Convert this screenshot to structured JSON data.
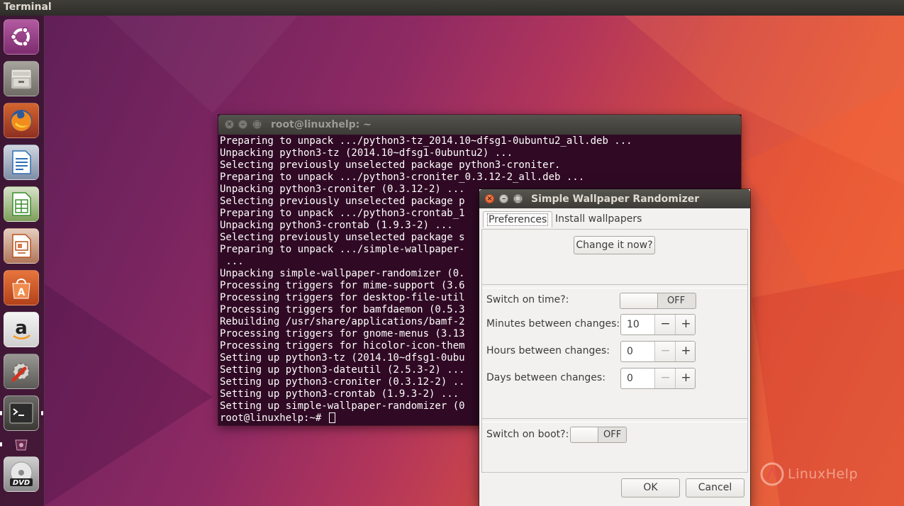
{
  "top_panel": {
    "title": "Terminal"
  },
  "launcher": {
    "items": [
      {
        "name": "dash-home",
        "icon": "ubuntu-logo-icon"
      },
      {
        "name": "files",
        "icon": "file-cabinet-icon"
      },
      {
        "name": "firefox",
        "icon": "firefox-icon"
      },
      {
        "name": "writer",
        "icon": "libreoffice-writer-icon"
      },
      {
        "name": "calc",
        "icon": "libreoffice-calc-icon"
      },
      {
        "name": "impress",
        "icon": "libreoffice-impress-icon"
      },
      {
        "name": "software-center",
        "icon": "shopping-bag-icon"
      },
      {
        "name": "amazon",
        "icon": "amazon-icon"
      },
      {
        "name": "system-settings",
        "icon": "settings-wrench-icon"
      },
      {
        "name": "terminal",
        "icon": "terminal-icon"
      },
      {
        "name": "wallpaper-randomizer",
        "icon": "small-app-icon"
      },
      {
        "name": "dvd",
        "icon": "dvd-icon"
      }
    ]
  },
  "terminal": {
    "title": "root@linuxhelp: ~",
    "lines": [
      "Preparing to unpack .../python3-tz_2014.10~dfsg1-0ubuntu2_all.deb ...",
      "Unpacking python3-tz (2014.10~dfsg1-0ubuntu2) ...",
      "Selecting previously unselected package python3-croniter.",
      "Preparing to unpack .../python3-croniter_0.3.12-2_all.deb ...",
      "Unpacking python3-croniter (0.3.12-2) ...",
      "Selecting previously unselected package p",
      "Preparing to unpack .../python3-crontab_1",
      "Unpacking python3-crontab (1.9.3-2) ...",
      "Selecting previously unselected package s",
      "Preparing to unpack .../simple-wallpaper-",
      " ...",
      "Unpacking simple-wallpaper-randomizer (0.",
      "Processing triggers for mime-support (3.6",
      "Processing triggers for desktop-file-util",
      "Processing triggers for bamfdaemon (0.5.3",
      "Rebuilding /usr/share/applications/bamf-2",
      "Processing triggers for gnome-menus (3.13",
      "Processing triggers for hicolor-icon-them",
      "Setting up python3-tz (2014.10~dfsg1-0ubu",
      "Setting up python3-dateutil (2.5.3-2) ...",
      "Setting up python3-croniter (0.3.12-2) ..",
      "Setting up python3-crontab (1.9.3-2) ...",
      "Setting up simple-wallpaper-randomizer (0"
    ],
    "prompt": "root@linuxhelp:~# "
  },
  "dialog": {
    "title": "Simple Wallpaper Randomizer",
    "tabs": [
      "Preferences",
      "Install wallpapers"
    ],
    "change_now_label": "Change it now?",
    "switch_time": {
      "label": "Switch on time?:",
      "state": "OFF"
    },
    "minutes": {
      "label": "Minutes between changes:",
      "value": "10"
    },
    "hours": {
      "label": "Hours between changes:",
      "value": "0"
    },
    "days": {
      "label": "Days between changes:",
      "value": "0"
    },
    "switch_boot": {
      "label": "Switch on boot?:",
      "state": "OFF"
    },
    "spin_minus": "−",
    "spin_plus": "+",
    "ok_label": "OK",
    "cancel_label": "Cancel"
  },
  "watermark": {
    "text": "LinuxHelp"
  },
  "colors": {
    "terminal_bg": "#300a24",
    "dialog_bg": "#f2f1f0",
    "close_button": "#e3531d",
    "panel": "#3c3b37"
  }
}
